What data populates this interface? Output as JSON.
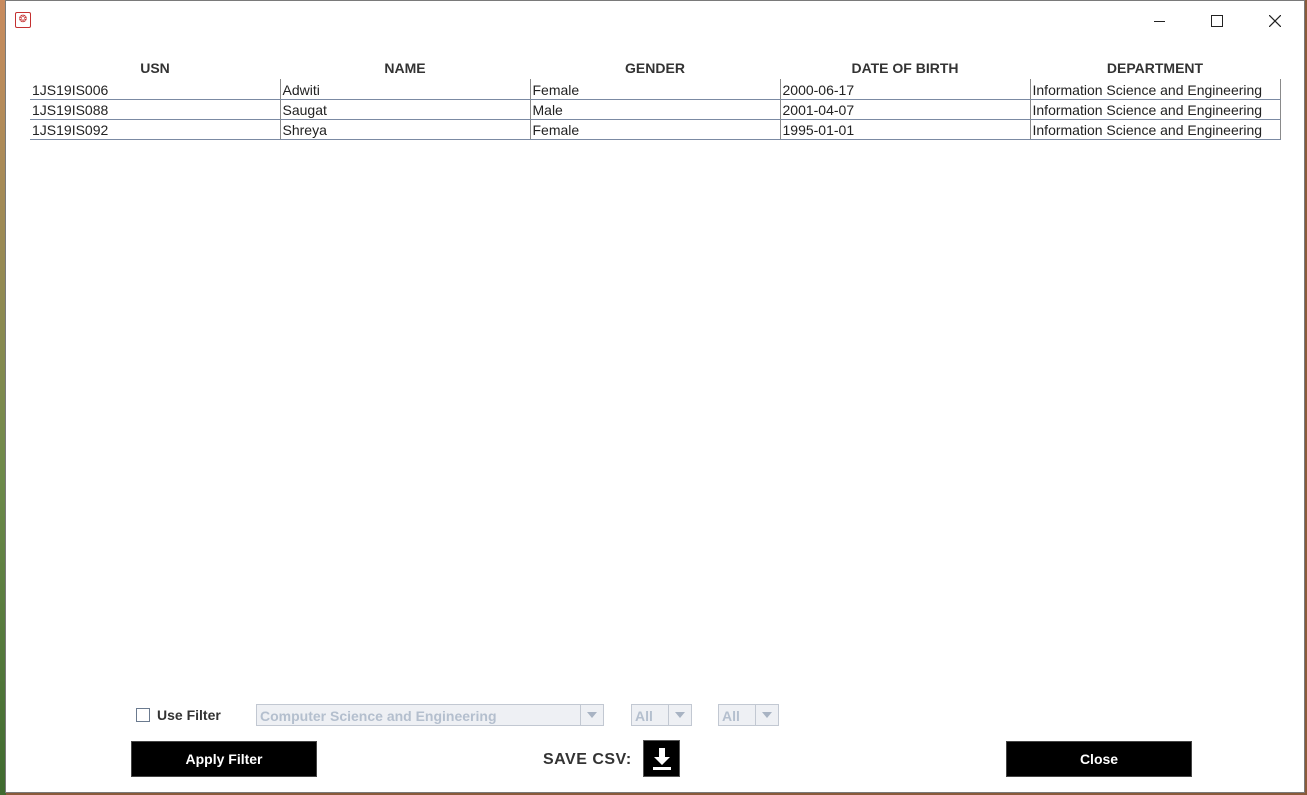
{
  "window": {
    "app_icon": "app-logo-icon"
  },
  "table": {
    "columns": [
      "USN",
      "NAME",
      "GENDER",
      "DATE OF BIRTH",
      "DEPARTMENT"
    ],
    "rows": [
      [
        "1JS19IS006",
        "Adwiti",
        "Female",
        "2000-06-17",
        "Information Science and Engineering"
      ],
      [
        "1JS19IS088",
        "Saugat",
        "Male",
        "2001-04-07",
        "Information Science and Engineering"
      ],
      [
        "1JS19IS092",
        "Shreya",
        "Female",
        "1995-01-01",
        "Information Science and Engineering"
      ]
    ]
  },
  "filter": {
    "use_filter_label": "Use Filter",
    "use_filter_checked": false,
    "department_selected": "Computer Science and Engineering",
    "second_selected": "All",
    "third_selected": "All"
  },
  "actions": {
    "apply_label": "Apply Filter",
    "save_csv_label": "SAVE CSV:",
    "save_icon": "download-icon",
    "close_label": "Close"
  }
}
